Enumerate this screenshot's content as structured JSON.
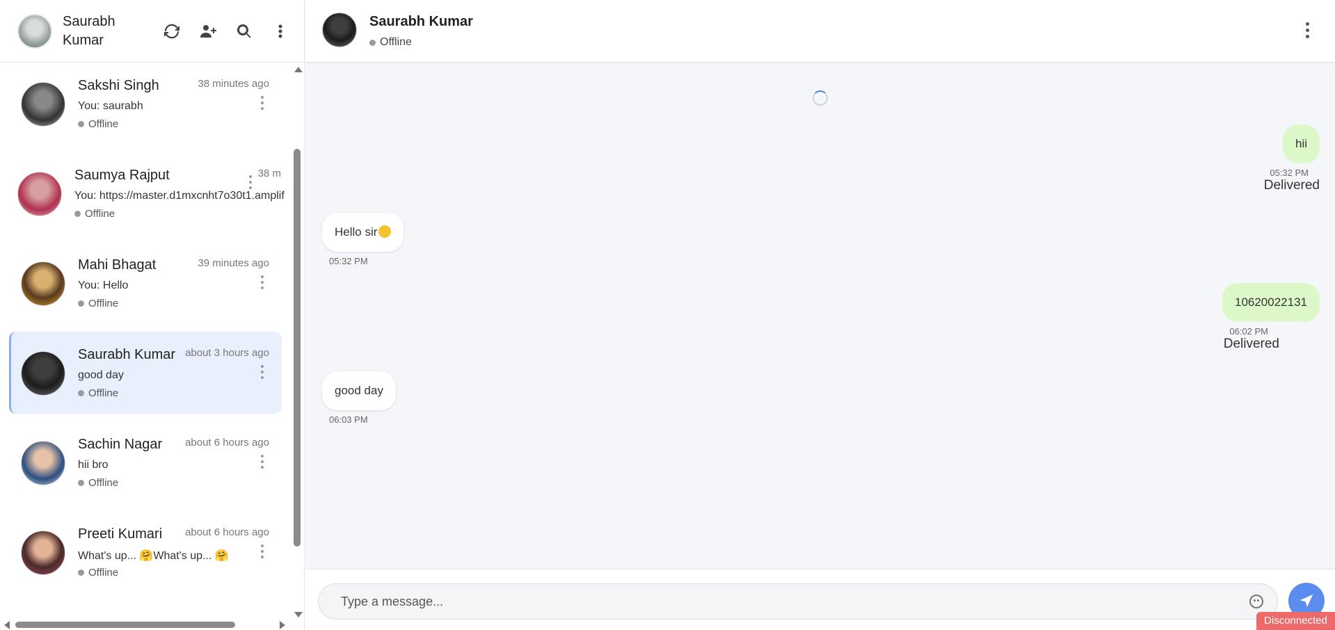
{
  "me": {
    "name": "Saurabh Kumar"
  },
  "sidebar": {
    "icons": [
      "refresh-icon",
      "add-user-icon",
      "search-icon",
      "more-vertical-icon"
    ],
    "conversations": [
      {
        "name": "Sakshi Singh",
        "time": "38 minutes ago",
        "last": "You: saurabh",
        "status": "Offline",
        "active": false
      },
      {
        "name": "Saumya Rajput",
        "time": "38 m",
        "last": "You: https://master.d1mxcnht7o30t1.amplif",
        "status": "Offline",
        "active": false
      },
      {
        "name": "Mahi Bhagat",
        "time": "39 minutes ago",
        "last": "You: Hello",
        "status": "Offline",
        "active": false
      },
      {
        "name": "Saurabh Kumar",
        "time": "about 3 hours ago",
        "last": "good day",
        "status": "Offline",
        "active": true
      },
      {
        "name": "Sachin Nagar",
        "time": "about 6 hours ago",
        "last": "hii bro",
        "status": "Offline",
        "active": false
      },
      {
        "name": "Preeti Kumari",
        "time": "about 6 hours ago",
        "last": "What's up... 🤗What's up... 🤗",
        "status": "Offline",
        "active": false
      }
    ]
  },
  "chat": {
    "contact_name": "Saurabh Kumar",
    "contact_status": "Offline",
    "messages": [
      {
        "dir": "out",
        "text": "hii",
        "time": "05:32 PM",
        "receipt": "Delivered"
      },
      {
        "dir": "in",
        "text": "Hello sir",
        "time": "05:32 PM",
        "emoji": "grinning-face"
      },
      {
        "dir": "out",
        "text": "10620022131",
        "time": "06:02 PM",
        "receipt": "Delivered"
      },
      {
        "dir": "in",
        "text": "good day",
        "time": "06:03 PM"
      }
    ]
  },
  "composer": {
    "placeholder": "Type a message..."
  },
  "connection": {
    "status": "Disconnected",
    "color": "#ee6a6a"
  },
  "colors": {
    "accent": "#5a8dee",
    "outgoing_bubble": "#dcf8c8",
    "active_conversation": "#e8f0fd"
  }
}
